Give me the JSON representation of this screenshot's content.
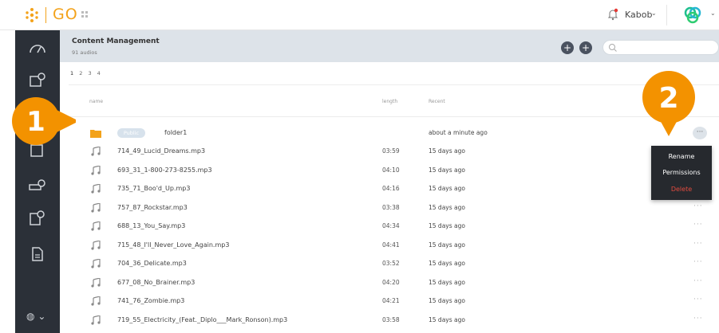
{
  "app": {
    "logo_text": "GO",
    "brand_color": "#f3a21a",
    "icons": {
      "logo": "dots-logo-icon",
      "apps": "apps-grid-icon",
      "bell": "bell-icon",
      "brand": "brand-circles-icon"
    }
  },
  "header": {
    "user_name": "Kabob",
    "chevron": "⌄"
  },
  "sidebar": {
    "items": [
      "dashboard-icon",
      "audio-icon",
      "users-icon",
      "media-icon",
      "screen-icon",
      "playlist-icon",
      "document-icon"
    ],
    "footer_icon": "globe-icon",
    "footer_chevron": "⌄"
  },
  "content": {
    "title": "Content Management",
    "subtitle": "91 audios",
    "add_folder_label": "+",
    "add_label": "+"
  },
  "pagination": {
    "pages": [
      "1",
      "2",
      "3",
      "4"
    ],
    "current": "1"
  },
  "table": {
    "columns": {
      "name": "name",
      "length": "length",
      "recent": "Recent"
    },
    "folder": {
      "badge": "Public",
      "name": "folder1",
      "recent": "about a minute ago"
    },
    "rows": [
      {
        "name": "714_49_Lucid_Dreams.mp3",
        "length": "03:59",
        "recent": "15 days ago"
      },
      {
        "name": "693_31_1-800-273-8255.mp3",
        "length": "04:10",
        "recent": "15 days ago"
      },
      {
        "name": "735_71_Boo'd_Up.mp3",
        "length": "04:16",
        "recent": "15 days ago"
      },
      {
        "name": "757_87_Rockstar.mp3",
        "length": "03:38",
        "recent": "15 days ago"
      },
      {
        "name": "688_13_You_Say.mp3",
        "length": "04:34",
        "recent": "15 days ago"
      },
      {
        "name": "715_48_I'll_Never_Love_Again.mp3",
        "length": "04:41",
        "recent": "15 days ago"
      },
      {
        "name": "704_36_Delicate.mp3",
        "length": "03:52",
        "recent": "15 days ago"
      },
      {
        "name": "677_08_No_Brainer.mp3",
        "length": "04:20",
        "recent": "15 days ago"
      },
      {
        "name": "741_76_Zombie.mp3",
        "length": "04:21",
        "recent": "15 days ago"
      },
      {
        "name": "719_55_Electricity_(Feat._Diplo___Mark_Ronson).mp3",
        "length": "03:58",
        "recent": "15 days ago"
      }
    ],
    "more_label": "···"
  },
  "context_menu": {
    "rename": "Rename",
    "permissions": "Permissions",
    "delete": "Delete",
    "delete_color": "#e24b3f"
  },
  "callouts": {
    "one": "1",
    "two": "2",
    "color": "#f39200"
  }
}
